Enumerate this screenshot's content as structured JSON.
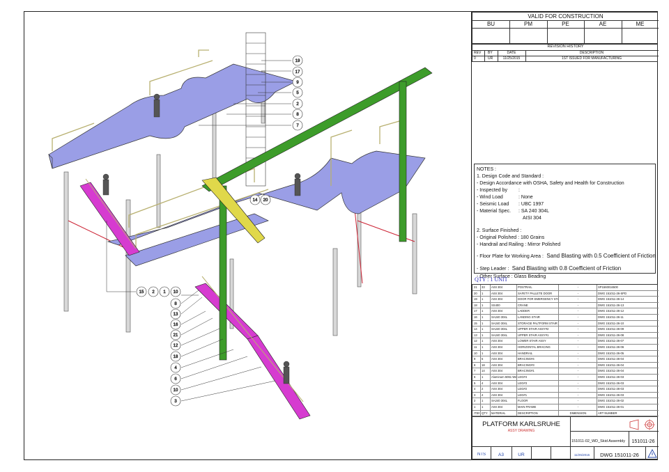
{
  "approval": {
    "title": "VALID FOR CONSTRUCTION",
    "columns": [
      "BU",
      "PM",
      "PE",
      "AE",
      "ME"
    ]
  },
  "revision": {
    "title": "REVISION HISTORY",
    "headers": [
      "REV",
      "BY",
      "DATE",
      "DESCRIPTION"
    ],
    "rows": [
      [
        "0",
        "UR",
        "11/25/2015",
        "1ST ISSUED FOR MANUFACTURING"
      ]
    ]
  },
  "notes": {
    "title": "NOTES :",
    "lines": [
      "1. Design Code and Standard :",
      "- Design Accordance with OSHA, Safety and Health for Construction",
      "- Inspected by",
      "- Wind Load",
      "- Seismic Load",
      "- Material Spec.",
      "",
      "",
      "2. Surface Finished :",
      "- Original Polished : 180 Grains",
      "- Handrail and Railing : Mirror Polished",
      "- Floor Plate for Working Area :",
      "- Step Leader :",
      "- Other Surface : Glass Beading"
    ],
    "values": {
      "inspected": ":",
      "wind": ": None",
      "seismic": ": UBC 1997",
      "material1": ": SA 240 304L",
      "material2": "AISI 304",
      "floor": "Sand Blasting with 0.5 Coefficient of Friction",
      "step": "Sand Blasting with 0.8 Coefficient of Friction"
    }
  },
  "qty": "QTY : 1 UNIT",
  "bom": {
    "headers": [
      "ITEM",
      "QTY",
      "MATERIAL",
      "DESCRIPTION",
      "DIMENSION",
      "ART NUMBER"
    ],
    "rows": [
      [
        "21",
        "33",
        "AISI 304",
        "POSTRAIL",
        "-",
        "SP1560016500"
      ],
      [
        "20",
        "1",
        "AISI 304",
        "SAFETY PALLETE DOOR",
        "-",
        "DWG 151011-26-SPD"
      ],
      [
        "19",
        "1",
        "AISI 304",
        "DOOR FOR EMERGENCY STAIR",
        "-",
        "DWG 151011-26-14"
      ],
      [
        "18",
        "1",
        "SS400",
        "CRANE",
        "-",
        "DWG 151011-26-13"
      ],
      [
        "17",
        "1",
        "AISI 304",
        "LADDER",
        "-",
        "DWG 151011-26-12"
      ],
      [
        "16",
        "1",
        "SA240 304L",
        "LANDING STAIR",
        "-",
        "DWG 151011-26-11"
      ],
      [
        "15",
        "1",
        "SA240 304L",
        "STORAGE PALTFORM STAIR ASSY",
        "-",
        "DWG 151011-26-10"
      ],
      [
        "14",
        "1",
        "SA240 304L",
        "UPPER STAIR ASSY#2",
        "-",
        "DWG 151011-26-09"
      ],
      [
        "13",
        "1",
        "SA240 304L",
        "UPPER STAIR ASSY#1",
        "-",
        "DWG 151011-26-08"
      ],
      [
        "12",
        "1",
        "AISI 304",
        "LOWER STAIR ASSY",
        "-",
        "DWG 151011-26-07"
      ],
      [
        "11",
        "1",
        "AISI 304",
        "HORIZONTAL BRACING",
        "-",
        "DWG 151011-26-06"
      ],
      [
        "10",
        "1",
        "AISI 304",
        "HANDRAIL",
        "-",
        "DWG 151011-26-05"
      ],
      [
        "9",
        "5",
        "AISI 304",
        "BRACING#4",
        "-",
        "DWG 151011-26-04"
      ],
      [
        "8",
        "18",
        "AISI 304",
        "BRACING#3",
        "-",
        "DWG 151011-26-04"
      ],
      [
        "7",
        "14",
        "AISI 304",
        "BRACING#1",
        "-",
        "DWG 151011-26-04"
      ],
      [
        "6",
        "1",
        "Aluminum 6061 Welded",
        "LEG#4",
        "-",
        "DWG 151011-26-03"
      ],
      [
        "5",
        "4",
        "AISI 304",
        "LEG#3",
        "-",
        "DWG 151011-26-03"
      ],
      [
        "4",
        "2",
        "AISI 304",
        "LEG#2",
        "-",
        "DWG 151011-26-03"
      ],
      [
        "3",
        "4",
        "AISI 304",
        "LEG#1",
        "-",
        "DWG 151011-26-03"
      ],
      [
        "2",
        "1",
        "SA240 304L",
        "FLOOR",
        "-",
        "DWG 151011-26-02"
      ],
      [
        "1",
        "1",
        "AISI 304",
        "MAIN FRAME",
        "-",
        "DWG 151011-26-01"
      ]
    ]
  },
  "title_block": {
    "title": "PLATFORM KARLSRUHE",
    "subtitle": "ASSY DRAWING",
    "file": "151011-02_WD_Skid Assembly",
    "project": "151011-26",
    "scale": "NTS",
    "size": "A3",
    "drawn": "UR",
    "date": "11/25/2015",
    "dwg": "DWG 151011-26"
  },
  "callouts": {
    "top_right": [
      "19",
      "17",
      "9",
      "5",
      "2",
      "8",
      "7"
    ],
    "mid": [
      "14",
      "20"
    ],
    "bottom_row": [
      "15",
      "2",
      "1",
      "10"
    ],
    "left_column": [
      "8",
      "13",
      "16",
      "21",
      "12",
      "18",
      "4",
      "6",
      "10",
      "3"
    ]
  },
  "colors": {
    "floor": "#9a9ee6",
    "stair": "#d63bd0",
    "crane": "#3d9c2a",
    "crane_arm": "#e0d84a",
    "handrail": "#b8b070",
    "leg": "#d8d8d8"
  }
}
